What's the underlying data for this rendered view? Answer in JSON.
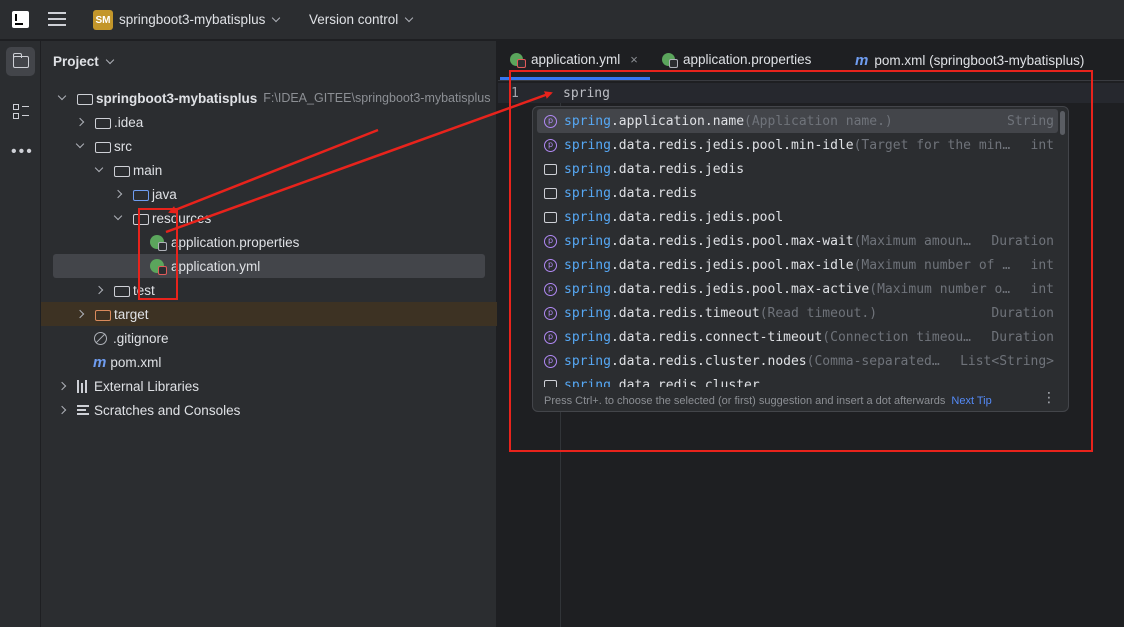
{
  "titlebar": {
    "project_badge": "SM",
    "project_name": "springboot3-mybatisplus",
    "vcs_label": "Version control"
  },
  "project_panel": {
    "title": "Project",
    "tree": [
      {
        "label": "springboot3-mybatisplus",
        "hint": "F:\\IDEA_GITEE\\springboot3-mybatisplus",
        "icon": "module-folder-icon"
      },
      {
        "label": ".idea",
        "icon": "folder-icon"
      },
      {
        "label": "src",
        "icon": "folder-icon"
      },
      {
        "label": "main",
        "icon": "folder-icon"
      },
      {
        "label": "java",
        "icon": "source-folder-icon"
      },
      {
        "label": "resources",
        "icon": "resources-folder-icon"
      },
      {
        "label": "application.properties",
        "icon": "spring-properties-icon"
      },
      {
        "label": "application.yml",
        "icon": "spring-yml-icon"
      },
      {
        "label": "test",
        "icon": "folder-icon"
      },
      {
        "label": "target",
        "icon": "excluded-folder-icon"
      },
      {
        "label": ".gitignore",
        "icon": "ignore-file-icon"
      },
      {
        "label": "pom.xml",
        "icon": "maven-icon"
      },
      {
        "label": "External Libraries",
        "icon": "libraries-icon"
      },
      {
        "label": "Scratches and Consoles",
        "icon": "scratches-icon"
      }
    ]
  },
  "editor": {
    "tabs": [
      {
        "label": "application.yml",
        "icon": "spring-yml-icon",
        "close": "×"
      },
      {
        "label": "application.properties",
        "icon": "spring-properties-icon"
      },
      {
        "label": "pom.xml (springboot3-mybatisplus)",
        "icon": "maven-icon",
        "prefix": "m"
      }
    ],
    "line_number": "1",
    "code_text": "spring"
  },
  "completion": {
    "items": [
      {
        "kind": "property",
        "match": "spring",
        "rest": ".application.name",
        "desc": "(Application name.)",
        "type": "String"
      },
      {
        "kind": "property",
        "match": "spring",
        "rest": ".data.redis.jedis.pool.min-idle",
        "desc": "(Target for the min…",
        "type": "int"
      },
      {
        "kind": "folder",
        "match": "spring",
        "rest": ".data.redis.jedis",
        "desc": "",
        "type": ""
      },
      {
        "kind": "folder",
        "match": "spring",
        "rest": ".data.redis",
        "desc": "",
        "type": ""
      },
      {
        "kind": "folder",
        "match": "spring",
        "rest": ".data.redis.jedis.pool",
        "desc": "",
        "type": ""
      },
      {
        "kind": "property",
        "match": "spring",
        "rest": ".data.redis.jedis.pool.max-wait",
        "desc": "(Maximum amoun…",
        "type": "Duration"
      },
      {
        "kind": "property",
        "match": "spring",
        "rest": ".data.redis.jedis.pool.max-idle",
        "desc": "(Maximum number of …",
        "type": "int"
      },
      {
        "kind": "property",
        "match": "spring",
        "rest": ".data.redis.jedis.pool.max-active",
        "desc": "(Maximum number o…",
        "type": "int"
      },
      {
        "kind": "property",
        "match": "spring",
        "rest": ".data.redis.timeout",
        "desc": "(Read timeout.)",
        "type": "Duration"
      },
      {
        "kind": "property",
        "match": "spring",
        "rest": ".data.redis.connect-timeout",
        "desc": "(Connection timeou…",
        "type": "Duration"
      },
      {
        "kind": "property",
        "match": "spring",
        "rest": ".data.redis.cluster.nodes",
        "desc": "(Comma-separated…",
        "type": "List<String>"
      },
      {
        "kind": "folder",
        "match": "spring",
        "rest": ".data.redis.cluster",
        "desc": "",
        "type": ""
      }
    ],
    "footer_text": "Press Ctrl+. to choose the selected (or first) suggestion and insert a dot afterwards",
    "next_tip": "Next Tip",
    "more_icon": "⋮"
  },
  "colors": {
    "annotation_red": "#e8231c",
    "accent_blue": "#3574f0",
    "match_blue": "#56a8f5"
  }
}
